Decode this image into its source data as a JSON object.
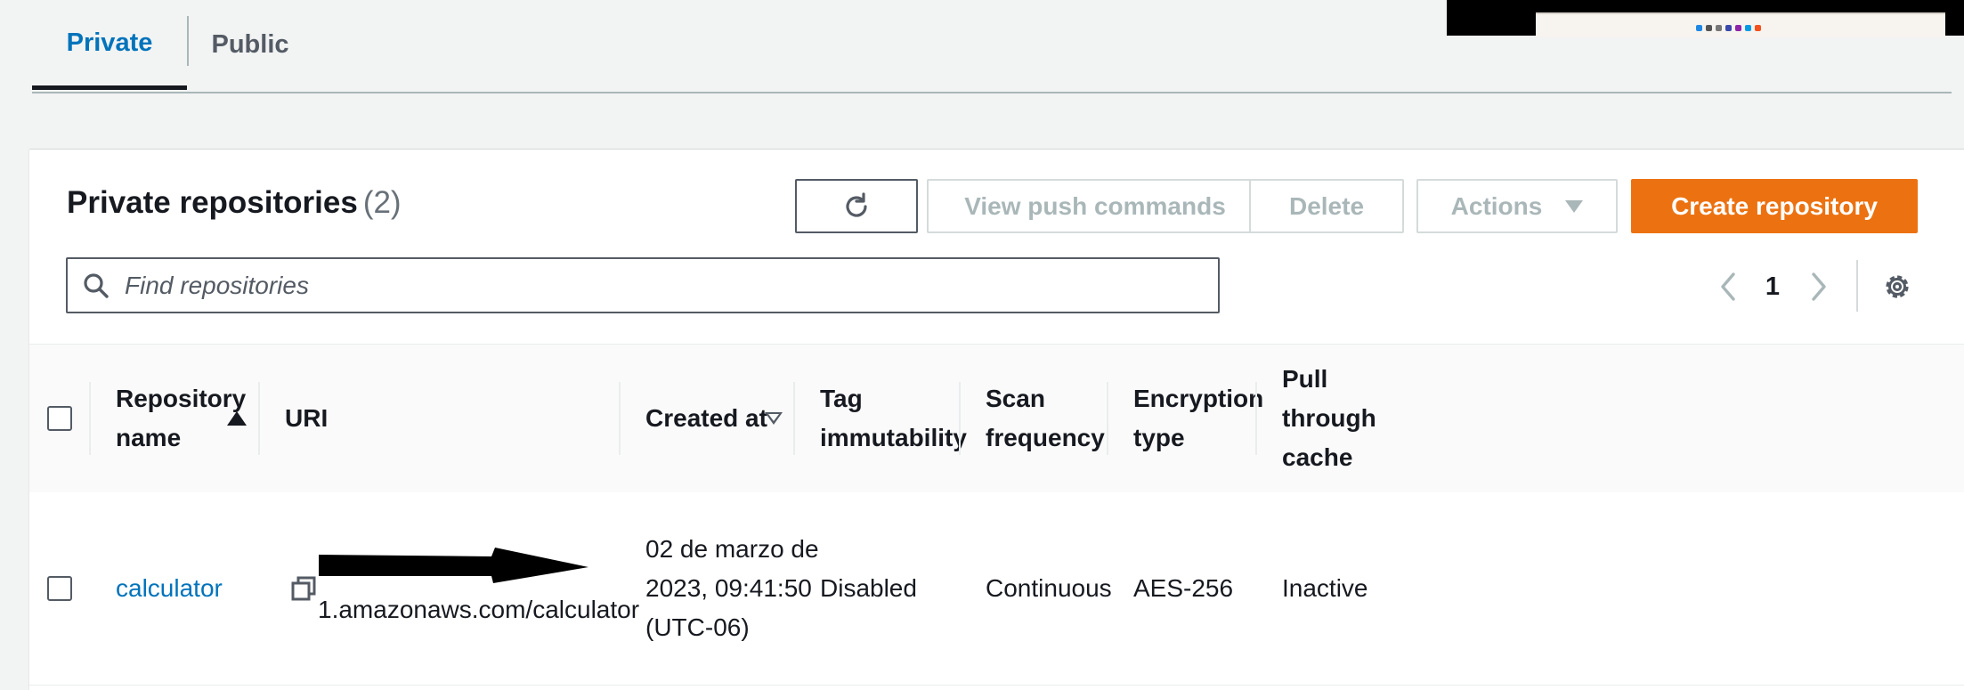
{
  "tabs": {
    "private": "Private",
    "public": "Public"
  },
  "panel": {
    "title": "Private repositories",
    "count": "(2)",
    "buttons": {
      "push": "View push commands",
      "delete": "Delete",
      "actions": "Actions",
      "create": "Create repository"
    },
    "search_placeholder": "Find repositories",
    "page": "1"
  },
  "columns": {
    "name": "Repository name",
    "uri": "URI",
    "created": "Created at",
    "tag": "Tag immutability",
    "scan": "Scan frequency",
    "encryption": "Encryption type",
    "pull": "Pull through cache"
  },
  "rows": [
    {
      "name": "calculator",
      "uri": "1.amazonaws.com/calculator",
      "created": "02 de marzo de 2023, 09:41:50 (UTC-06)",
      "tag": "Disabled",
      "scan": "Continuous",
      "encryption": "AES-256",
      "pull": "Inactive"
    }
  ],
  "colors": {
    "accent": "#0073bb",
    "primary": "#ec7211",
    "disabled": "#aab7b8"
  }
}
